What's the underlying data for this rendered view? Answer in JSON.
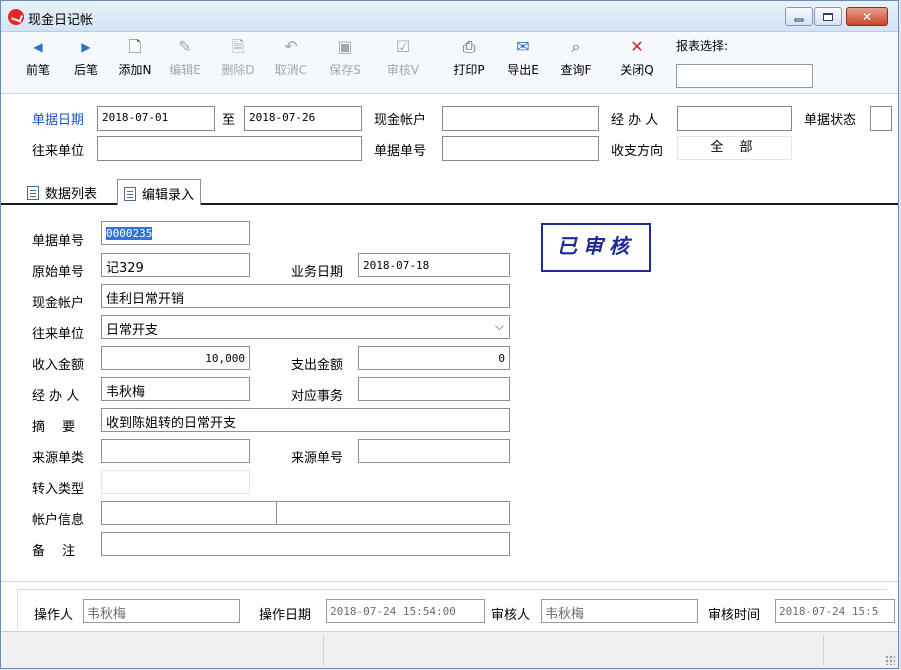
{
  "window": {
    "title": "现金日记帐"
  },
  "toolbar": {
    "buttons": [
      {
        "label": "前笔",
        "icon": "◀",
        "enabled": true
      },
      {
        "label": "后笔",
        "icon": "▶",
        "enabled": true
      },
      {
        "label": "添加N",
        "icon": "🗋",
        "enabled": true
      },
      {
        "label": "编辑E",
        "icon": "✎",
        "enabled": false
      },
      {
        "label": "删除D",
        "icon": "🗎",
        "enabled": false
      },
      {
        "label": "取消C",
        "icon": "↶",
        "enabled": false
      },
      {
        "label": "保存S",
        "icon": "▣",
        "enabled": false
      },
      {
        "label": "审核V",
        "icon": "☑",
        "enabled": false
      },
      {
        "label": "打印P",
        "icon": "⎙",
        "enabled": true
      },
      {
        "label": "导出E",
        "icon": "✉",
        "enabled": true
      },
      {
        "label": "查询F",
        "icon": "⌕",
        "enabled": true
      },
      {
        "label": "关闭Q",
        "icon": "✕",
        "enabled": true
      }
    ],
    "report_label": "报表选择:",
    "report_value": ""
  },
  "filter": {
    "date_label": "单据日期",
    "date_from": "2018-07-01",
    "to_label": "至",
    "date_to": "2018-07-26",
    "account_label": "现金帐户",
    "account_value": "",
    "handler_label": "经 办 人",
    "handler_value": "",
    "status_label": "单据状态",
    "party_label": "往来单位",
    "party_value": "",
    "docno_label": "单据单号",
    "docno_value": "",
    "direction_label": "收支方向",
    "direction_value": "全 部"
  },
  "tabs": [
    {
      "label": "数据列表"
    },
    {
      "label": "编辑录入"
    }
  ],
  "form": {
    "doc_no_label": "单据单号",
    "doc_no": "0000235",
    "orig_no_label": "原始单号",
    "orig_no": "记329",
    "biz_date_label": "业务日期",
    "biz_date": "2018-07-18",
    "account_label": "现金帐户",
    "account": "佳利日常开销",
    "party_label": "往来单位",
    "party": "日常开支",
    "income_label": "收入金额",
    "income": "10,000",
    "expense_label": "支出金额",
    "expense": "0",
    "handler_label": "经 办 人",
    "handler": "韦秋梅",
    "matter_label": "对应事务",
    "matter": "",
    "summary_label": "摘　 要",
    "summary": "收到陈姐转的日常开支",
    "source_type_label": "来源单类",
    "source_type": "",
    "source_no_label": "来源单号",
    "source_no": "",
    "transfer_type_label": "转入类型",
    "transfer_type": "",
    "account_info_label": "帐户信息",
    "account_info_1": "",
    "account_info_2": "",
    "remark_label": "备　 注",
    "remark": "",
    "stamp": "已审核"
  },
  "footer": {
    "operator_label": "操作人",
    "operator": "韦秋梅",
    "op_date_label": "操作日期",
    "op_date": "2018-07-24 15:54:00",
    "auditor_label": "审核人",
    "auditor": "韦秋梅",
    "audit_time_label": "审核时间",
    "audit_time": "2018-07-24 15:5"
  }
}
